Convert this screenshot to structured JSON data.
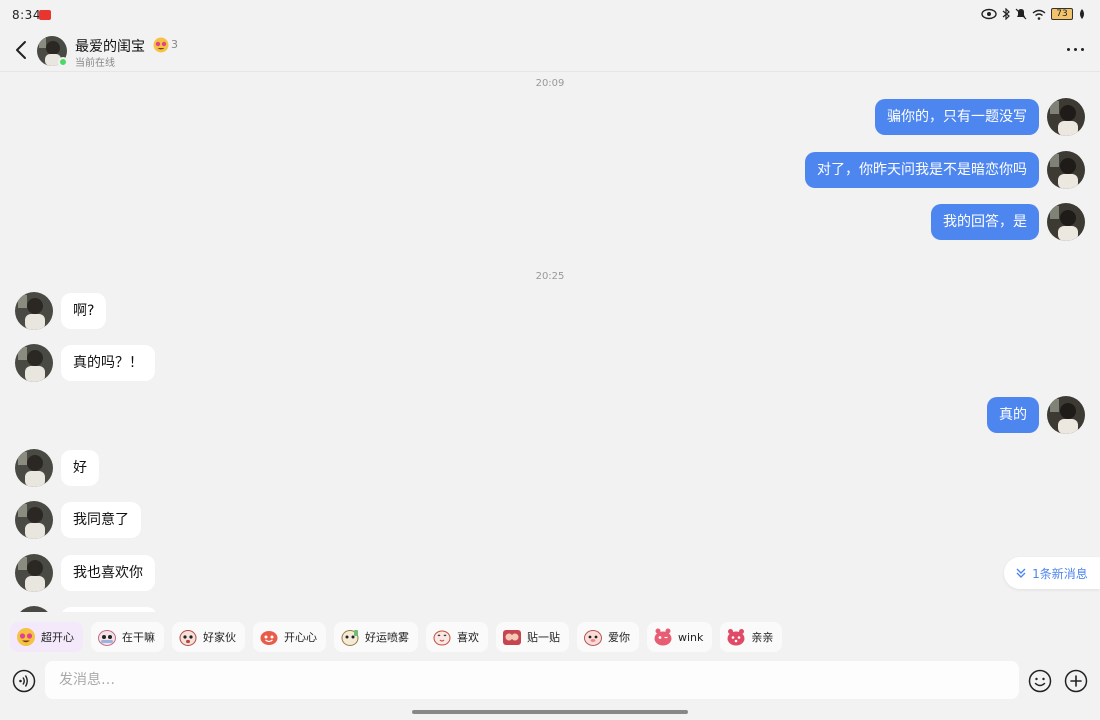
{
  "status_bar": {
    "time": "8:34",
    "battery": "73"
  },
  "header": {
    "contact_name": "最爱的闺宝",
    "level": "3",
    "status": "当前在线"
  },
  "messages": [
    {
      "type": "time",
      "text": "20:09"
    },
    {
      "type": "out",
      "text": "骗你的，只有一题没写"
    },
    {
      "type": "out",
      "text": "对了，你昨天问我是不是暗恋你吗"
    },
    {
      "type": "out",
      "text": "我的回答，是"
    },
    {
      "type": "time",
      "text": "20:25"
    },
    {
      "type": "in",
      "text": "啊?"
    },
    {
      "type": "in",
      "text": "真的吗？！"
    },
    {
      "type": "out",
      "text": "真的"
    },
    {
      "type": "in",
      "text": "好"
    },
    {
      "type": "in",
      "text": "我同意了"
    },
    {
      "type": "in",
      "text": "我也喜欢你"
    }
  ],
  "new_messages_pill": "1条新消息",
  "sticker_suggestions": [
    {
      "label": "超开心",
      "icon": "star-eyes-sticker"
    },
    {
      "label": "在干嘛",
      "icon": "peek-sticker"
    },
    {
      "label": "好家伙",
      "icon": "surprised-sticker"
    },
    {
      "label": "开心心",
      "icon": "happy-sticker"
    },
    {
      "label": "好运喷雾",
      "icon": "spray-sticker"
    },
    {
      "label": "喜欢",
      "icon": "like-sticker"
    },
    {
      "label": "贴一贴",
      "icon": "hug-sticker"
    },
    {
      "label": "爱你",
      "icon": "love-sticker"
    },
    {
      "label": "wink",
      "icon": "wink-sticker"
    },
    {
      "label": "亲亲",
      "icon": "kiss-sticker"
    }
  ],
  "input": {
    "placeholder": "发消息…",
    "value": ""
  },
  "colors": {
    "outgoing_bubble": "#4e86f0",
    "incoming_bubble": "#ffffff",
    "background": "#f2f2f2",
    "online": "#4cd964"
  }
}
